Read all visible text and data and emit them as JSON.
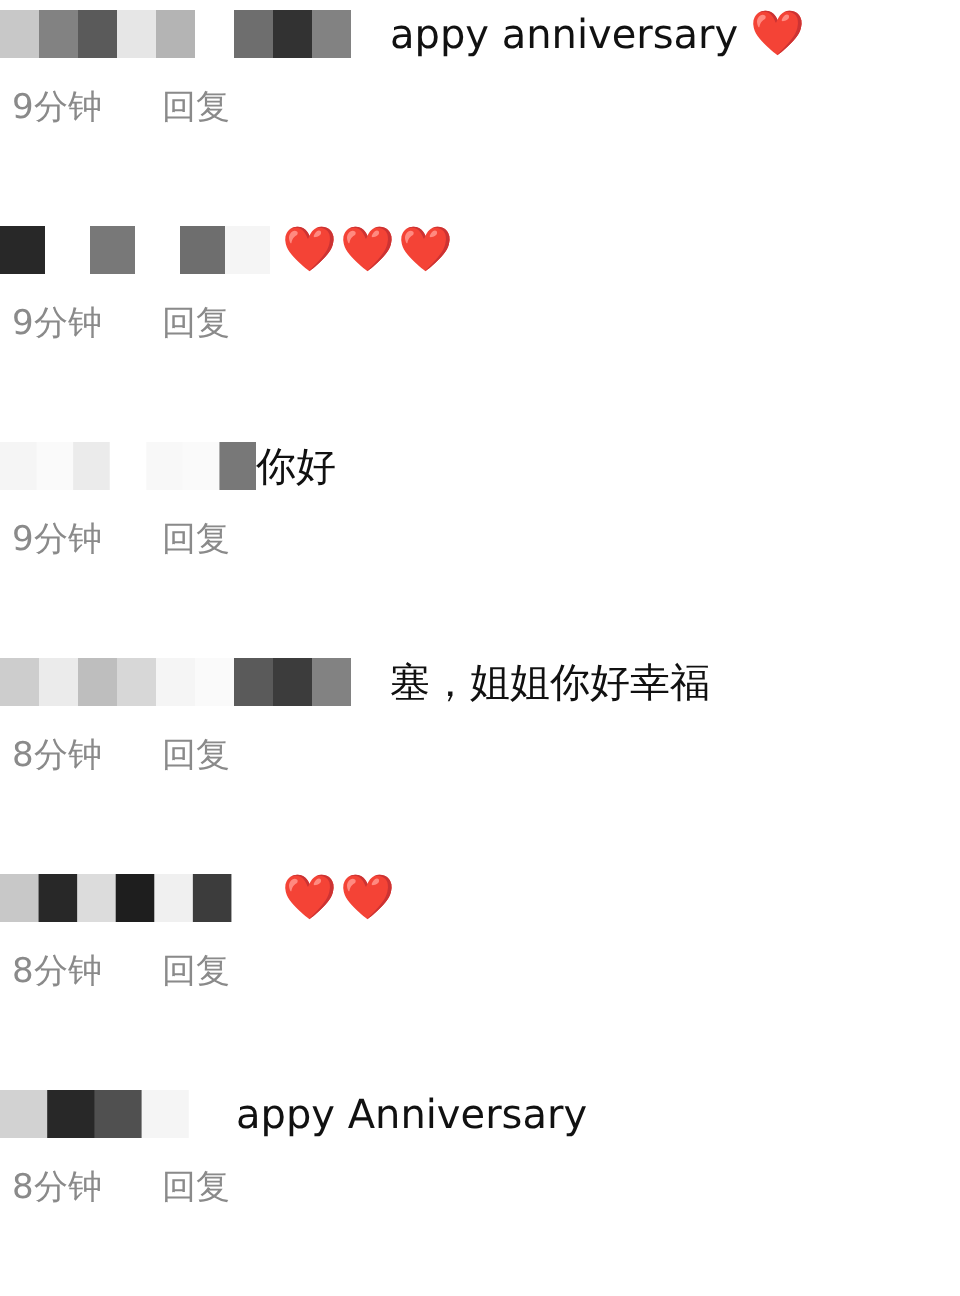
{
  "comments": [
    {
      "text": "appy anniversary",
      "emoji": "❤️",
      "time": "9分钟",
      "reply": "回复"
    },
    {
      "emoji": "❤️❤️❤️",
      "time": "9分钟",
      "reply": "回复"
    },
    {
      "text": "你好",
      "time": "9分钟",
      "reply": "回复"
    },
    {
      "text": "塞，姐姐你好幸福",
      "time": "8分钟",
      "reply": "回复"
    },
    {
      "emoji": "❤️❤️",
      "time": "8分钟",
      "reply": "回复"
    },
    {
      "text": "appy Anniversary",
      "time": "8分钟",
      "reply": "回复"
    }
  ]
}
